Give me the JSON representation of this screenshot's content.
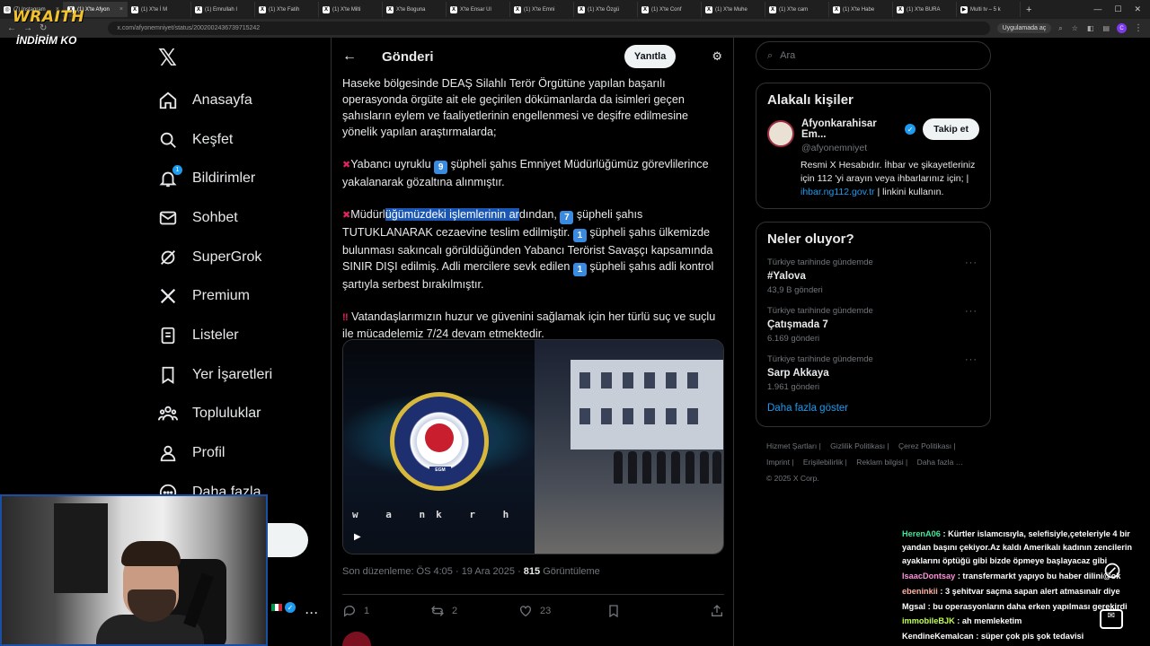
{
  "browser": {
    "tabs": [
      {
        "label": "(7) Instagram",
        "active": false
      },
      {
        "label": "(1) X'te Afyon",
        "active": true
      },
      {
        "label": "(1) X'te İ M",
        "active": false
      },
      {
        "label": "(1) Emrullah I",
        "active": false
      },
      {
        "label": "(1) X'te Fatih",
        "active": false
      },
      {
        "label": "(1) X'te Milti",
        "active": false
      },
      {
        "label": "X'te Boguna",
        "active": false
      },
      {
        "label": "X'te Ensar Ul",
        "active": false
      },
      {
        "label": "(1) X'te Emni",
        "active": false
      },
      {
        "label": "(1) X'te Özgü",
        "active": false
      },
      {
        "label": "(1) X'te Conf",
        "active": false
      },
      {
        "label": "(1) X'te Muhe",
        "active": false
      },
      {
        "label": "(1) X'te cam",
        "active": false
      },
      {
        "label": "(1) X'te Habe",
        "active": false
      },
      {
        "label": "(1) X'te BURA",
        "active": false
      },
      {
        "label": "Multi tv – 5 k",
        "active": false
      }
    ],
    "url": "x.com/afyonemniyet/status/2002002436739715242",
    "install_label": "Uygulamada aç",
    "profile_initial": "C"
  },
  "overlay": {
    "logo": "WRAITH",
    "promo": "İNDİRİM KO"
  },
  "nav": {
    "items": [
      {
        "label": "Anasayfa",
        "icon": "home-icon"
      },
      {
        "label": "Keşfet",
        "icon": "search-icon"
      },
      {
        "label": "Bildirimler",
        "icon": "bell-icon",
        "badge": "1"
      },
      {
        "label": "Sohbet",
        "icon": "mail-icon"
      },
      {
        "label": "SuperGrok",
        "icon": "grok-icon"
      },
      {
        "label": "Premium",
        "icon": "x-icon"
      },
      {
        "label": "Listeler",
        "icon": "list-icon"
      },
      {
        "label": "Yer İşaretleri",
        "icon": "bookmark-icon"
      },
      {
        "label": "Topluluklar",
        "icon": "people-icon"
      },
      {
        "label": "Profil",
        "icon": "user-icon"
      },
      {
        "label": "Daha fazla",
        "icon": "more-icon"
      }
    ],
    "post_label": "a"
  },
  "main": {
    "title": "Gönderi",
    "reply_label": "Yanıtla",
    "p1": "Haseke bölgesinde DEAŞ Silahlı Terör Örgütüne yapılan başarılı operasyonda örgüte ait ele geçirilen dökümanlarda da isimleri geçen şahısların eylem ve faaliyetlerinin engellenmesi ve deşifre edilmesine yönelik yapılan araştırmalarda;",
    "p2_pre": "Yabancı uyruklu",
    "p2_num": "9",
    "p2_post": "şüpheli şahıs Emniyet Müdürlüğümüz görevlilerince yakalanarak gözaltına alınmıştır.",
    "p3_a": "Müdürl",
    "p3_hl": "üğümüzdeki işlemlerinin ar",
    "p3_b": "dından,",
    "p3_num1": "7",
    "p3_c": "şüpheli şahıs TUTUKLANARAK cezaevine teslim edilmiştir.",
    "p3_num2": "1",
    "p3_d": "şüpheli şahıs ülkemizde bulunması sakıncalı görüldüğünden Yabancı Terörist Savaşçı kapsamında SINIR DIŞI edilmiş. Adli mercilere sevk edilen",
    "p3_num3": "1",
    "p3_e": "şüpheli şahıs adli kontrol şartıyla serbest bırakılmıştır.",
    "p4": "Vatandaşlarımızın huzur ve güvenini sağlamak için her türlü suç ve suçlu ile mücadelemiz 7/24 devam etmektedir.",
    "media_watermark": "w a nk r h i ar",
    "media_badge_label": "EGM",
    "meta_time": "Son düzenleme: ÖS 4:05 · 19 Ara 2025 · ",
    "meta_views": "815",
    "meta_views_label": " Görüntüleme",
    "actions": {
      "replies": "1",
      "reposts": "2",
      "likes": "23"
    }
  },
  "right": {
    "search_placeholder": "Ara",
    "related_title": "Alakalı kişiler",
    "person": {
      "name": "Afyonkarahisar Em...",
      "handle": "@afyonemniyet",
      "follow_label": "Takip et",
      "bio_a": "Resmi X Hesabıdır. İhbar ve şikayetleriniz için 112 'yi arayın veya ihbarlarınız için; |",
      "bio_link": "ihbar.ng112.gov.tr",
      "bio_b": "| linkini kullanın."
    },
    "trends_title": "Neler oluyor?",
    "trends": [
      {
        "category": "Türkiye tarihinde gündemde",
        "name": "#Yalova",
        "count": "43,9 B gönderi"
      },
      {
        "category": "Türkiye tarihinde gündemde",
        "name": "Çatışmada 7",
        "count": "6.169 gönderi"
      },
      {
        "category": "Türkiye tarihinde gündemde",
        "name": "Sarp Akkaya",
        "count": "1.961 gönderi"
      }
    ],
    "show_more": "Daha fazla göster",
    "footer": [
      "Hizmet Şartları |",
      "Gizlilik Politikası |",
      "Çerez Politikası |",
      "Imprint |",
      "Erişilebilirlik |",
      "Reklam bilgisi |",
      "Daha fazla …",
      "© 2025 X Corp."
    ]
  },
  "chat": [
    {
      "user": "HerenA06",
      "text": ": Kürtler islamcısıyla, selefisiyle,çeteleriyle 4 bir yandan başını çekiyor.Az kaldı Amerikalı kadının zencilerin ayaklarını öptüğü gibi bizde öpmeye başlayacaz gibi"
    },
    {
      "user": "IsaacDontsay",
      "text": ": transfermarkt yapıyo bu haber dilini@ok"
    },
    {
      "user": "ebeninkii",
      "text": ": 3 şehitvar saçma sapan alert atmasınalr diye"
    },
    {
      "user": "Mgsal",
      "text": ": bu operasyonların daha erken yapılması gerekirdi"
    },
    {
      "user": "immobileBJK",
      "text": ": ah memleketim"
    },
    {
      "user": "KendineKemalcan",
      "text": ": süper çok pis şok tedavisi"
    }
  ]
}
